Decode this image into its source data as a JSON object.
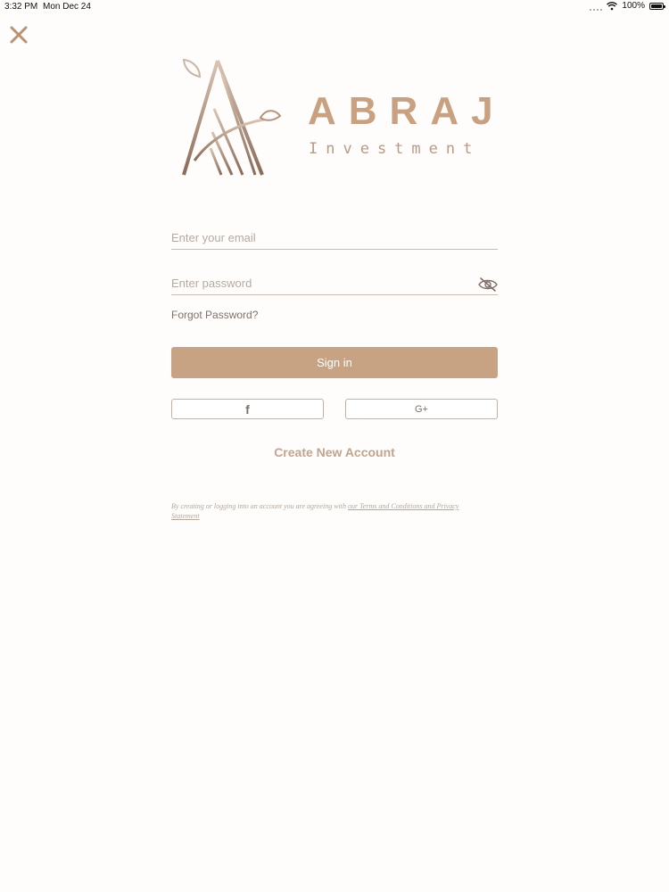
{
  "status_bar": {
    "time": "3:32 PM",
    "date": "Mon Dec 24",
    "battery": "100%",
    "battery_level": 1.0
  },
  "logo": {
    "word": "ABRAJ",
    "sub": "Investment"
  },
  "form": {
    "email_placeholder": "Enter your email",
    "password_placeholder": "Enter password",
    "forgot_label": "Forgot Password?",
    "signin_label": "Sign in",
    "create_account_label": "Create New Account"
  },
  "social": {
    "facebook_glyph": "f",
    "google_glyph": "G+"
  },
  "terms": {
    "text": "By creating or logging into an account you are agreeing with ",
    "link": "our Terms and Conditions and Privacy Statement"
  },
  "colors": {
    "accent": "#c7a283",
    "background": "#fffdfb"
  },
  "icons": [
    "close-icon",
    "eye-slash-icon",
    "facebook-icon",
    "google-plus-icon",
    "wifi-icon",
    "battery-icon"
  ]
}
